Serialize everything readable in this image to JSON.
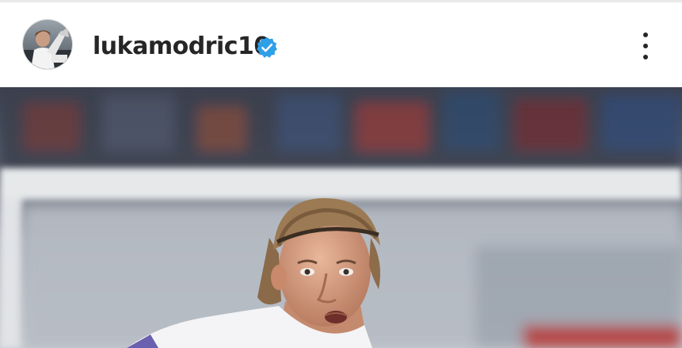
{
  "post": {
    "username": "lukamodric10",
    "verified": true,
    "avatar_icon": "profile-avatar",
    "more_icon": "more-options-icon",
    "verified_icon": "verified-badge-icon"
  },
  "colors": {
    "verified_blue": "#2f9fe8",
    "text": "#262626"
  }
}
